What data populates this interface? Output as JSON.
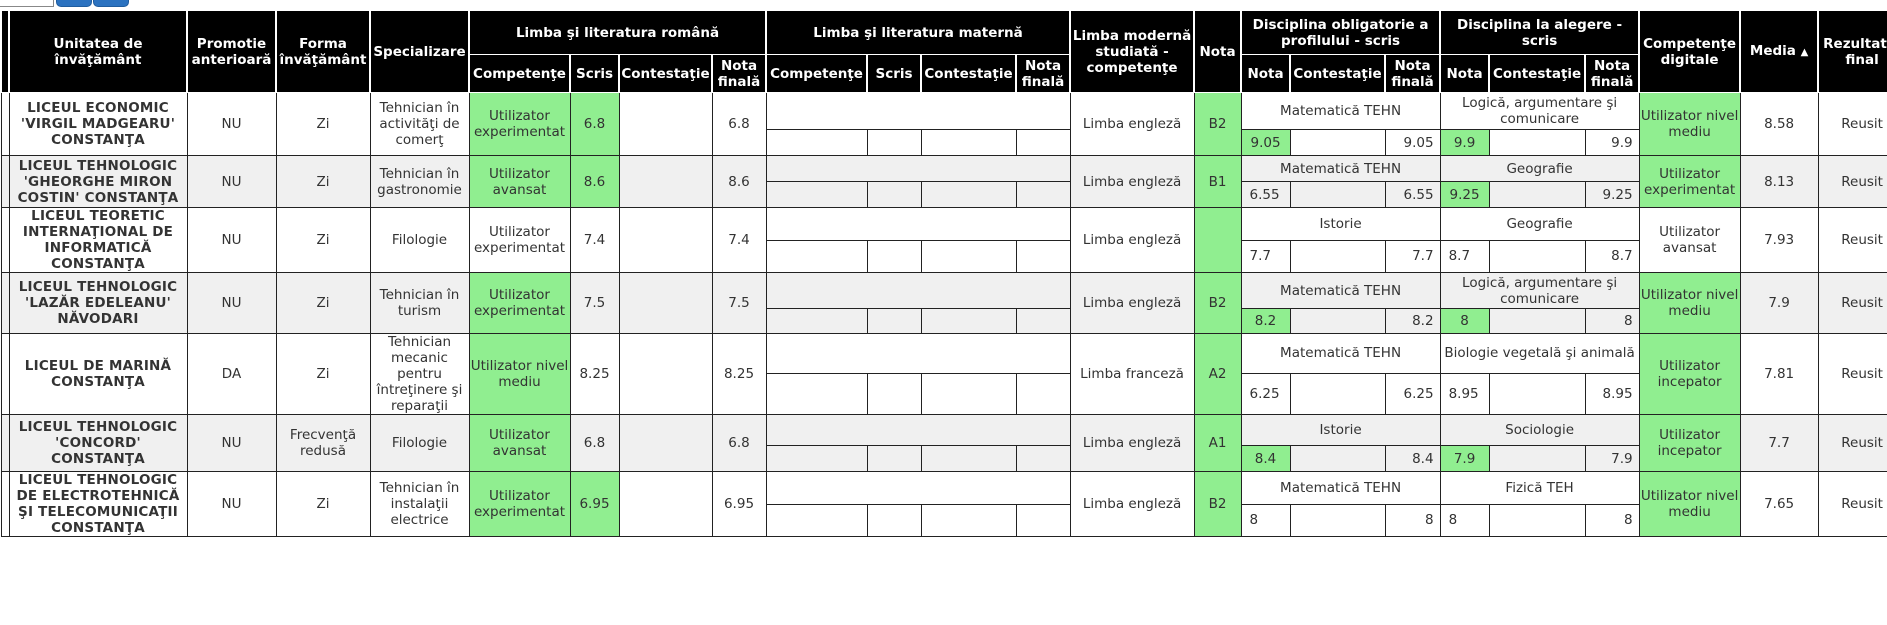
{
  "headers": {
    "unitate": "Unitatea de învăţământ",
    "promotie": "Promotie anterioară",
    "forma": "Forma învăţământ",
    "specializare": "Specializare",
    "lrom_group": "Limba şi literatura română",
    "lmat_group": "Limba şi literatura maternă",
    "lmod": "Limba modernă studiată - competenţe",
    "nota": "Nota",
    "obl_group": "Disciplina obligatorie a profilului - scris",
    "ale_group": "Disciplina la alegere - scris",
    "competente_dig": "Competenţe digitale",
    "media": "Media",
    "media_arrow": "▲",
    "rezultat": "Rezultatul final",
    "sub_competente": "Competenţe",
    "sub_scris": "Scris",
    "sub_contestatie": "Contestaţie",
    "sub_nota_finala": "Nota finală",
    "sub_nota": "Nota"
  },
  "rows": [
    {
      "unit": "LICEUL ECONOMIC 'VIRGIL MADGEARU' CONSTANŢA",
      "promotie": "NU",
      "forma": "Zi",
      "spec": "Tehnician în activităţi de comerţ",
      "lrom_comp": "Utilizator experimentat",
      "lrom_scris": "6.8",
      "lrom_contest": "",
      "lrom_final": "6.8",
      "lmod": "Limba engleză",
      "nota": "B2",
      "obl_subject": "Matematică TEHN",
      "obl_nota": "9.05",
      "obl_contest": "",
      "obl_final": "9.05",
      "ale_subject": "Logică, argumentare şi comunicare",
      "ale_nota": "9.9",
      "ale_contest": "",
      "ale_final": "9.9",
      "dig": "Utilizator nivel mediu",
      "media": "8.58",
      "rezultat": "Reusit"
    },
    {
      "unit": "LICEUL TEHNOLOGIC 'GHEORGHE MIRON COSTIN' CONSTANŢA",
      "promotie": "NU",
      "forma": "Zi",
      "spec": "Tehnician în gastronomie",
      "lrom_comp": "Utilizator avansat",
      "lrom_scris": "8.6",
      "lrom_contest": "",
      "lrom_final": "8.6",
      "lmod": "Limba engleză",
      "nota": "B1",
      "obl_subject": "Matematică TEHN",
      "obl_nota": "6.55",
      "obl_contest": "",
      "obl_final": "6.55",
      "ale_subject": "Geografie",
      "ale_nota": "9.25",
      "ale_contest": "",
      "ale_final": "9.25",
      "dig": "Utilizator experimentat",
      "media": "8.13",
      "rezultat": "Reusit"
    },
    {
      "unit": "LICEUL TEORETIC INTERNAŢIONAL DE INFORMATICĂ CONSTANŢA",
      "promotie": "NU",
      "forma": "Zi",
      "spec": "Filologie",
      "lrom_comp": "Utilizator experimentat",
      "lrom_scris": "7.4",
      "lrom_contest": "",
      "lrom_final": "7.4",
      "lmod": "Limba engleză",
      "nota": "",
      "obl_subject": "Istorie",
      "obl_nota": "7.7",
      "obl_contest": "",
      "obl_final": "7.7",
      "ale_subject": "Geografie",
      "ale_nota": "8.7",
      "ale_contest": "",
      "ale_final": "8.7",
      "dig": "Utilizator avansat",
      "media": "7.93",
      "rezultat": "Reusit"
    },
    {
      "unit": "LICEUL TEHNOLOGIC 'LAZĂR EDELEANU' NĂVODARI",
      "promotie": "NU",
      "forma": "Zi",
      "spec": "Tehnician în turism",
      "lrom_comp": "Utilizator experimentat",
      "lrom_scris": "7.5",
      "lrom_contest": "",
      "lrom_final": "7.5",
      "lmod": "Limba engleză",
      "nota": "B2",
      "obl_subject": "Matematică TEHN",
      "obl_nota": "8.2",
      "obl_contest": "",
      "obl_final": "8.2",
      "ale_subject": "Logică, argumentare şi comunicare",
      "ale_nota": "8",
      "ale_contest": "",
      "ale_final": "8",
      "dig": "Utilizator nivel mediu",
      "media": "7.9",
      "rezultat": "Reusit"
    },
    {
      "unit": "LICEUL DE MARINĂ CONSTANŢA",
      "promotie": "DA",
      "forma": "Zi",
      "spec": "Tehnician mecanic pentru întreţinere şi reparaţii",
      "lrom_comp": "Utilizator nivel mediu",
      "lrom_scris": "8.25",
      "lrom_contest": "",
      "lrom_final": "8.25",
      "lmod": "Limba franceză",
      "nota": "A2",
      "obl_subject": "Matematică TEHN",
      "obl_nota": "6.25",
      "obl_contest": "",
      "obl_final": "6.25",
      "ale_subject": "Biologie vegetală şi animală",
      "ale_nota": "8.95",
      "ale_contest": "",
      "ale_final": "8.95",
      "dig": "Utilizator incepator",
      "media": "7.81",
      "rezultat": "Reusit"
    },
    {
      "unit": "LICEUL TEHNOLOGIC 'CONCORD' CONSTANŢA",
      "promotie": "NU",
      "forma": "Frecvenţă redusă",
      "spec": "Filologie",
      "lrom_comp": "Utilizator avansat",
      "lrom_scris": "6.8",
      "lrom_contest": "",
      "lrom_final": "6.8",
      "lmod": "Limba engleză",
      "nota": "A1",
      "obl_subject": "Istorie",
      "obl_nota": "8.4",
      "obl_contest": "",
      "obl_final": "8.4",
      "ale_subject": "Sociologie",
      "ale_nota": "7.9",
      "ale_contest": "",
      "ale_final": "7.9",
      "dig": "Utilizator incepator",
      "media": "7.7",
      "rezultat": "Reusit"
    },
    {
      "unit": "LICEUL TEHNOLOGIC DE ELECTROTEHNICĂ ŞI TELECOMUNICAŢII CONSTANŢA",
      "promotie": "NU",
      "forma": "Zi",
      "spec": "Tehnician în instalaţii electrice",
      "lrom_comp": "Utilizator experimentat",
      "lrom_scris": "6.95",
      "lrom_contest": "",
      "lrom_final": "6.95",
      "lmod": "Limba engleză",
      "nota": "B2",
      "obl_subject": "Matematică TEHN",
      "obl_nota": "8",
      "obl_contest": "",
      "obl_final": "8",
      "ale_subject": "Fizică TEH",
      "ale_nota": "8",
      "ale_contest": "",
      "ale_final": "8",
      "dig": "Utilizator nivel mediu",
      "media": "7.65",
      "rezultat": "Reusit"
    }
  ],
  "highlight_color": "#90ee90",
  "link_color": "#1f5faa",
  "header_bg": "#000000"
}
